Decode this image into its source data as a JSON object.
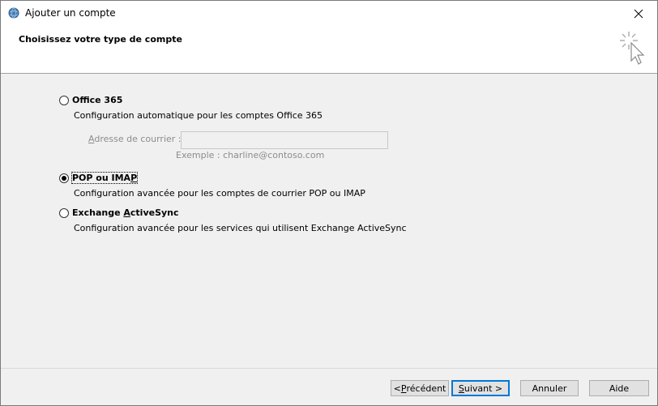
{
  "window": {
    "title": "Ajouter un compte",
    "app_icon": "globe-mail-icon",
    "close_icon": "close-icon"
  },
  "header": {
    "title": "Choisissez votre type de compte",
    "icon": "sparkle-cursor-icon"
  },
  "options": [
    {
      "label": "Office 365",
      "description": "Configuration automatique pour les comptes Office 365",
      "selected": false
    },
    {
      "label_pre": "POP ou IMA",
      "label_mnemonic": "P",
      "label_post": "",
      "description": "Configuration avancée pour les comptes de courrier POP ou IMAP",
      "selected": true
    },
    {
      "label_pre": "Exchange ",
      "label_mnemonic": "A",
      "label_post": "ctiveSync",
      "description": "Configuration avancée pour les services qui utilisent Exchange ActiveSync",
      "selected": false
    }
  ],
  "email_field": {
    "label_mnemonic": "A",
    "label_rest": "dresse de courrier :",
    "value": "",
    "example": "Exemple : charline@contoso.com"
  },
  "buttons": {
    "back": {
      "pre": "< ",
      "mnemonic": "P",
      "post": "récédent"
    },
    "next": {
      "mnemonic": "S",
      "post": "uivant >"
    },
    "cancel": "Annuler",
    "help": "Aide"
  },
  "colors": {
    "default_button_border": "#0078d7",
    "disabled_text": "#8c8c8c"
  }
}
